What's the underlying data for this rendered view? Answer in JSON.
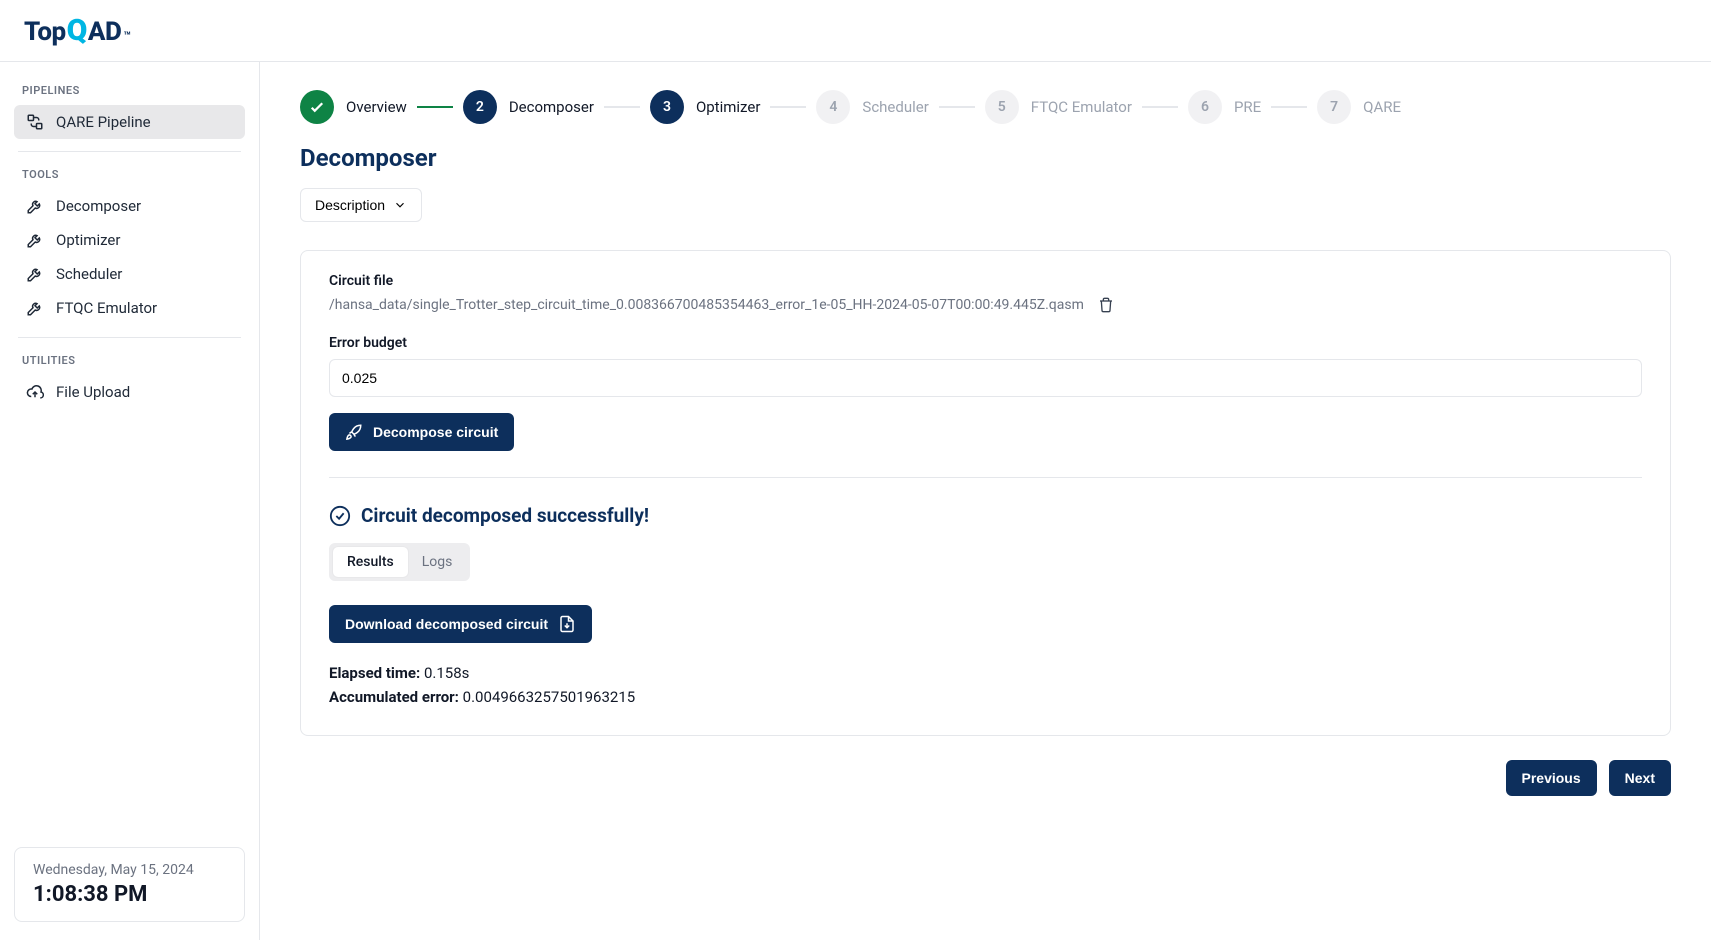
{
  "logo": {
    "part1": "Top",
    "part2": "Q",
    "part3": "AD",
    "tm": "™"
  },
  "sidebar": {
    "sections": {
      "pipelines": {
        "title": "PIPELINES",
        "items": [
          {
            "label": "QARE Pipeline"
          }
        ]
      },
      "tools": {
        "title": "TOOLS",
        "items": [
          {
            "label": "Decomposer"
          },
          {
            "label": "Optimizer"
          },
          {
            "label": "Scheduler"
          },
          {
            "label": "FTQC Emulator"
          }
        ]
      },
      "utilities": {
        "title": "UTILITIES",
        "items": [
          {
            "label": "File Upload"
          }
        ]
      }
    },
    "clock": {
      "date": "Wednesday, May 15, 2024",
      "time": "1:08:38 PM"
    }
  },
  "stepper": [
    {
      "num": "✓",
      "label": "Overview",
      "state": "done"
    },
    {
      "num": "2",
      "label": "Decomposer",
      "state": "active"
    },
    {
      "num": "3",
      "label": "Optimizer",
      "state": "active"
    },
    {
      "num": "4",
      "label": "Scheduler",
      "state": "pending"
    },
    {
      "num": "5",
      "label": "FTQC Emulator",
      "state": "pending"
    },
    {
      "num": "6",
      "label": "PRE",
      "state": "pending"
    },
    {
      "num": "7",
      "label": "QARE",
      "state": "pending"
    }
  ],
  "page": {
    "title": "Decomposer",
    "description_toggle": "Description",
    "circuit_file_label": "Circuit file",
    "circuit_file_value": "/hansa_data/single_Trotter_step_circuit_time_0.008366700485354463_error_1e-05_HH-2024-05-07T00:00:49.445Z.qasm",
    "error_budget_label": "Error budget",
    "error_budget_value": "0.025",
    "decompose_button": "Decompose circuit",
    "success_message": "Circuit decomposed successfully!",
    "tabs": {
      "results": "Results",
      "logs": "Logs"
    },
    "download_button": "Download decomposed circuit",
    "elapsed_label": "Elapsed time:",
    "elapsed_value": "0.158s",
    "accum_label": "Accumulated error:",
    "accum_value": "0.0049663257501963215",
    "nav": {
      "previous": "Previous",
      "next": "Next"
    }
  }
}
